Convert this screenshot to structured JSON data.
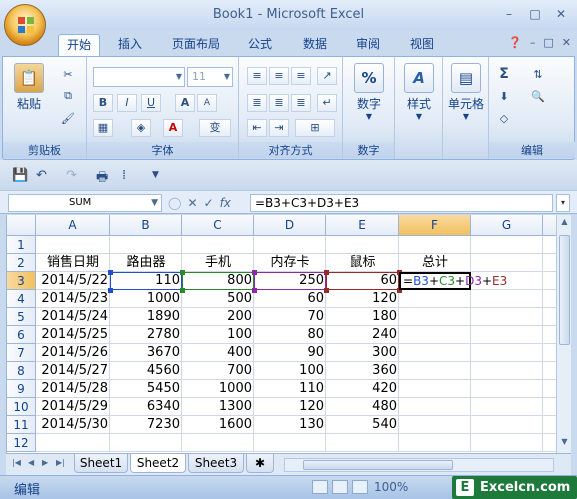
{
  "window": {
    "title": "Book1 - Microsoft Excel",
    "minimize": "–",
    "restore": "□",
    "close": "✕"
  },
  "tabs": [
    "开始",
    "插入",
    "页面布局",
    "公式",
    "数据",
    "审阅",
    "视图"
  ],
  "ribbon": {
    "clipboard": {
      "label": "剪贴板",
      "paste": "粘贴"
    },
    "font": {
      "label": "字体",
      "size": "11",
      "bold": "B",
      "italic": "I",
      "underline": "U",
      "grow": "A",
      "shrink": "A",
      "color": "A",
      "phonetic": "变"
    },
    "alignment": {
      "label": "对齐方式"
    },
    "number": {
      "label": "数字",
      "icon": "%"
    },
    "styles": {
      "label": "样式",
      "icon": "A"
    },
    "cells": {
      "label": "单元格"
    },
    "editing": {
      "label": "编辑",
      "sum": "Σ"
    }
  },
  "formula_bar": {
    "name_box": "SUM",
    "cancel": "✕",
    "enter": "✓",
    "fx": "fx",
    "formula": "=B3+C3+D3+E3"
  },
  "sheet": {
    "columns": [
      "A",
      "B",
      "C",
      "D",
      "E",
      "F",
      "G"
    ],
    "rows": [
      "1",
      "2",
      "3",
      "4",
      "5",
      "6",
      "7",
      "8",
      "9",
      "10",
      "11",
      "12"
    ],
    "headers": [
      "销售日期",
      "路由器",
      "手机",
      "内存卡",
      "鼠标",
      "总计"
    ],
    "data": [
      [
        "2014/5/22",
        "110",
        "800",
        "250",
        "60"
      ],
      [
        "2014/5/23",
        "1000",
        "500",
        "60",
        "120"
      ],
      [
        "2014/5/24",
        "1890",
        "200",
        "70",
        "180"
      ],
      [
        "2014/5/25",
        "2780",
        "100",
        "80",
        "240"
      ],
      [
        "2014/5/26",
        "3670",
        "400",
        "90",
        "300"
      ],
      [
        "2014/5/27",
        "4560",
        "700",
        "100",
        "360"
      ],
      [
        "2014/5/28",
        "5450",
        "1000",
        "110",
        "420"
      ],
      [
        "2014/5/29",
        "6340",
        "1300",
        "120",
        "480"
      ],
      [
        "2014/5/30",
        "7230",
        "1600",
        "130",
        "540"
      ]
    ],
    "edit_formula": {
      "eq": "=",
      "b": "B3",
      "p1": "+",
      "c": "C3",
      "p2": "+",
      "d": "D3",
      "p3": "+",
      "e": "E3"
    },
    "ref_colors": {
      "b3": "#2050d0",
      "c3": "#2a8a2a",
      "d3": "#8a2aa8",
      "e3": "#9a2a2a"
    }
  },
  "sheet_tabs": [
    "Sheet1",
    "Sheet2",
    "Sheet3"
  ],
  "status": {
    "mode": "编辑",
    "zoom": "100%"
  },
  "watermark": {
    "icon": "E",
    "text": "Excelcn.com"
  }
}
